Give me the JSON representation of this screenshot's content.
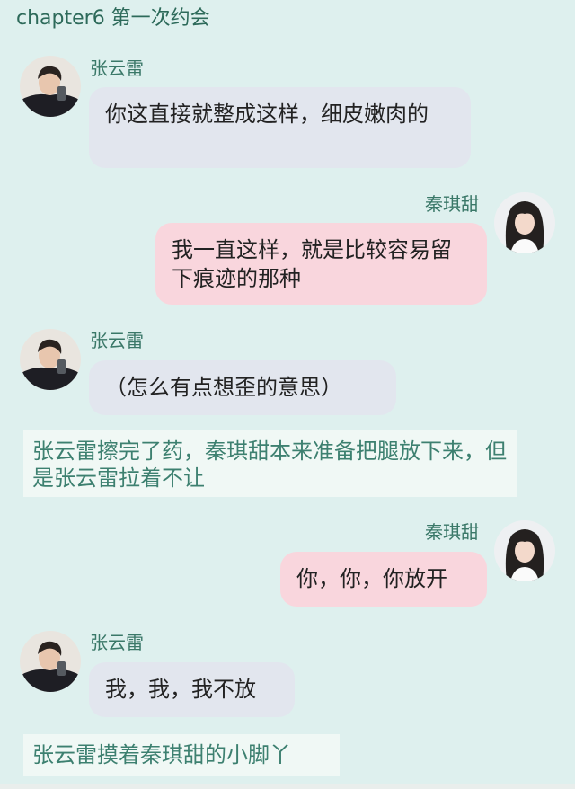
{
  "header": {
    "title": "chapter6 第一次约会"
  },
  "characters": {
    "male": {
      "name": "张云雷",
      "avatar_icon": "male-portrait-icon"
    },
    "female": {
      "name": "秦琪甜",
      "avatar_icon": "female-portrait-icon"
    }
  },
  "messages": [
    {
      "speaker": "张云雷",
      "side": "left",
      "text": "你这直接就整成这样，细皮嫩肉的"
    },
    {
      "speaker": "秦琪甜",
      "side": "right",
      "text": "我一直这样，就是比较容易留下痕迹的那种"
    },
    {
      "speaker": "张云雷",
      "side": "left",
      "text": "（怎么有点想歪的意思）"
    },
    {
      "narration": "张云雷擦完了药，秦琪甜本来准备把腿放下来，但是张云雷拉着不让"
    },
    {
      "speaker": "秦琪甜",
      "side": "right",
      "text": "你，你，你放开"
    },
    {
      "speaker": "张云雷",
      "side": "left",
      "text": "我，我，我不放"
    },
    {
      "narration": "张云雷摸着秦琪甜的小脚丫"
    }
  ],
  "colors": {
    "background": "#def0ee",
    "left_bubble": "#e2e6ee",
    "right_bubble": "#f9d6dd",
    "narration_bg": "#f0f8f5",
    "name_text": "#3a7868"
  }
}
